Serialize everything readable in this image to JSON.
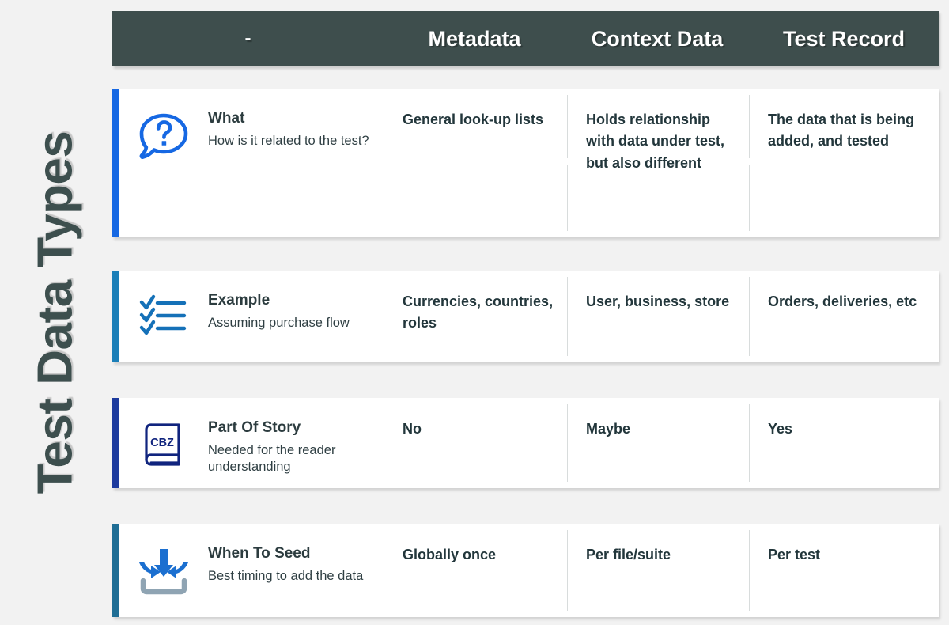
{
  "side_title": "Test Data Types",
  "theme": {
    "page_bg": "#f2f2f2",
    "header_bg": "#3e4e4d",
    "header_text": "#ffffff",
    "row_bg": "#ffffff",
    "body_text": "#22363b",
    "divider": "#d8dcdc"
  },
  "header": {
    "columns": [
      {
        "label": "-"
      },
      {
        "label": "Metadata"
      },
      {
        "label": "Context Data"
      },
      {
        "label": "Test Record"
      }
    ]
  },
  "rows": [
    {
      "accent_color": "#1668e3",
      "icon": "question-speech-bubble-icon",
      "title": "What",
      "subtitle": "How is it related to the test?",
      "metadata": "General look-up lists",
      "context_data": "Holds relationship with data under test, but also different",
      "test_record": "The data that is being added, and tested"
    },
    {
      "accent_color": "#1b7fb8",
      "icon": "checklist-icon",
      "title": "Example",
      "subtitle": "Assuming purchase flow",
      "metadata": "Currencies, countries, roles",
      "context_data": "User, business, store",
      "test_record": "Orders, deliveries, etc"
    },
    {
      "accent_color": "#1d3b9e",
      "icon": "book-cbz-icon",
      "icon_text": "CBZ",
      "title": "Part Of Story",
      "subtitle": "Needed for the reader understanding",
      "metadata": "No",
      "context_data": "Maybe",
      "test_record": "Yes"
    },
    {
      "accent_color": "#1f6e95",
      "icon": "seed-import-arrows-icon",
      "title": "When To Seed",
      "subtitle": "Best timing to add the data",
      "metadata": "Globally once",
      "context_data": "Per file/suite",
      "test_record": "Per test"
    }
  ]
}
